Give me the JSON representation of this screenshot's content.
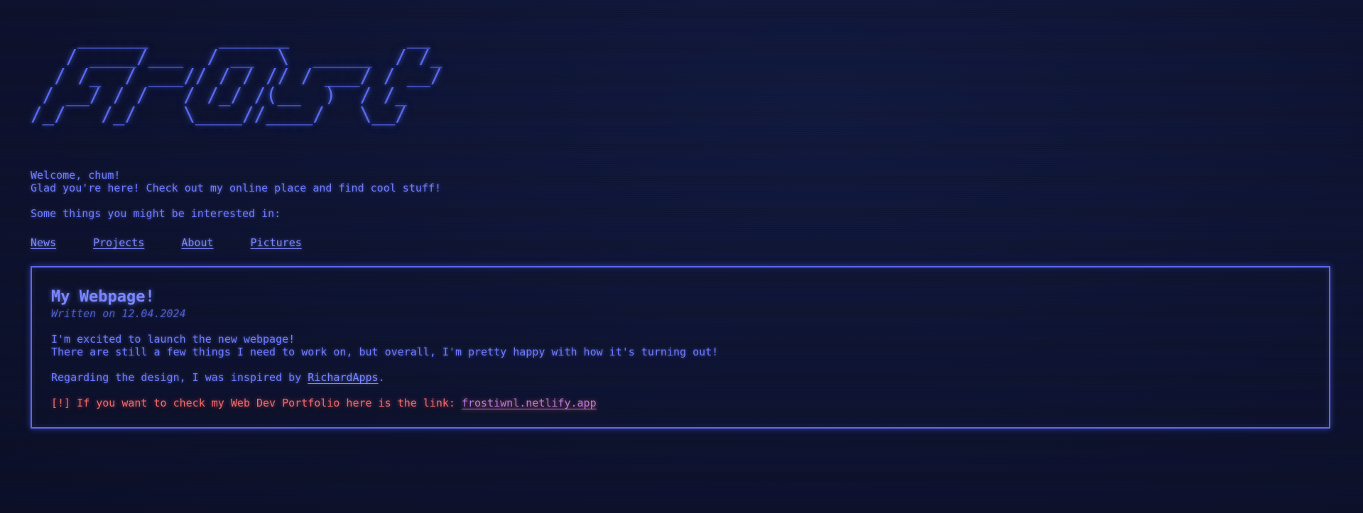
{
  "logo": {
    "ascii": "    ______      ______          __\n   / ____/___  / __  \\  _____  / /_\n  / /_  / ___// / / // / ___/ / __/\n / __/ / /   / /_/ /(__  )  / /_\n/_/   /_/    \\____//____/   \\__/"
  },
  "intro": {
    "line1": "Welcome, chum!",
    "line2": "Glad you're here! Check out my online place and find cool stuff!",
    "interest": "Some things you might be interested in:"
  },
  "nav": {
    "items": [
      {
        "label": "News"
      },
      {
        "label": "Projects"
      },
      {
        "label": "About"
      },
      {
        "label": "Pictures"
      }
    ]
  },
  "post": {
    "title": "My Webpage!",
    "date": "Written on 12.04.2024",
    "p1_line1": "I'm excited to launch the new webpage!",
    "p1_line2": "There are still a few things I need to work on, but overall, I'm pretty happy with how it's turning out!",
    "p2_prefix": "Regarding the design, I was inspired by ",
    "p2_link": "RichardApps",
    "p2_suffix": ".",
    "p3_prefix": "[!] If you want to check my Web Dev Portfolio here is the link: ",
    "p3_link": "frostiwnl.netlify.app"
  },
  "colors": {
    "background": "#0f1433",
    "text": "#6f7bff",
    "border": "#5c68f0",
    "warning": "#f06a6a"
  }
}
